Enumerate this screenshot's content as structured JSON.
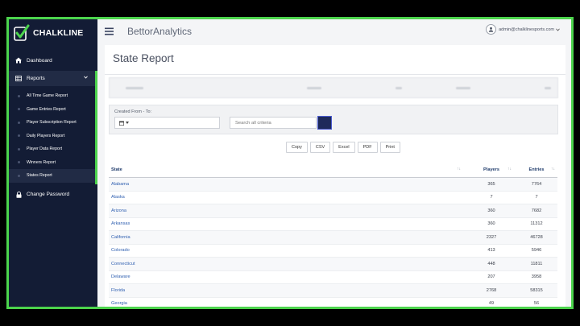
{
  "brand": {
    "name": "CHALKLINE",
    "accent": "#4cd34c"
  },
  "topbar": {
    "app_title": "BettorAnalytics",
    "user_email": "admin@chalklinesports.com"
  },
  "sidebar": {
    "dashboard": "Dashboard",
    "reports": "Reports",
    "submenu": [
      "All Time Game Report",
      "Game Entries Report",
      "Player Subscription Report",
      "Daily Players Report",
      "Player Data Report",
      "Winners Report",
      "States Report"
    ],
    "change_password": "Change Password"
  },
  "page": {
    "title": "State Report"
  },
  "filters": {
    "created_label": "Created From - To:",
    "search_placeholder": "Search all criteria"
  },
  "exports": [
    "Copy",
    "CSV",
    "Excel",
    "PDF",
    "Print"
  ],
  "table": {
    "headers": {
      "state": "State",
      "players": "Players",
      "entries": "Entries"
    },
    "rows": [
      {
        "state": "Alabama",
        "players": "365",
        "entries": "7764"
      },
      {
        "state": "Alaska",
        "players": "7",
        "entries": "7"
      },
      {
        "state": "Arizona",
        "players": "360",
        "entries": "7682"
      },
      {
        "state": "Arkansas",
        "players": "360",
        "entries": "11312"
      },
      {
        "state": "California",
        "players": "2327",
        "entries": "46728"
      },
      {
        "state": "Colorado",
        "players": "413",
        "entries": "5946"
      },
      {
        "state": "Connecticut",
        "players": "448",
        "entries": "11811"
      },
      {
        "state": "Delaware",
        "players": "207",
        "entries": "3958"
      },
      {
        "state": "Florida",
        "players": "2768",
        "entries": "58315"
      },
      {
        "state": "Georgia",
        "players": "49",
        "entries": "56"
      }
    ]
  }
}
